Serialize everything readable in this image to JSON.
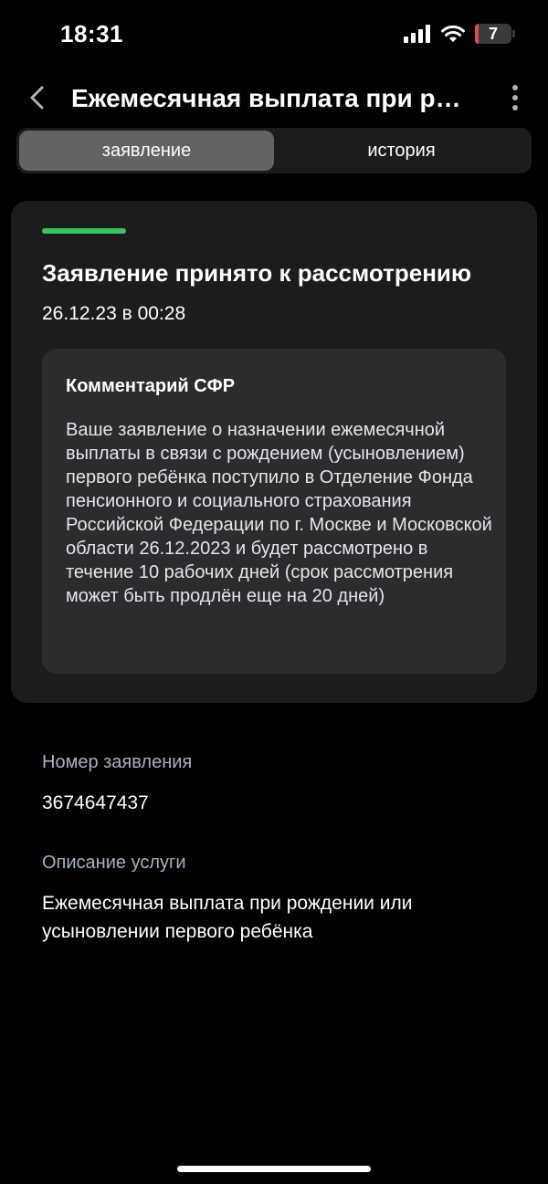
{
  "status_bar": {
    "time": "18:31",
    "battery_level": "7",
    "icons": [
      "cellular-signal-icon",
      "wifi-icon",
      "battery-icon"
    ]
  },
  "header": {
    "title": "Ежемесячная выплата при рождении или усыновлении первого ребёнка",
    "back_icon": "chevron-left-icon",
    "more_icon": "more-vertical-icon"
  },
  "tabs": [
    {
      "label": "заявление",
      "active": true
    },
    {
      "label": "история",
      "active": false
    }
  ],
  "status_card": {
    "title": "Заявление принято к рассмотрению",
    "date": "26.12.23 в 00:28",
    "accent_color": "#34c759",
    "comment": {
      "title": "Комментарий СФР",
      "body": "Ваше заявление о назначении ежемесячной выплаты в связи с рождением (усыновлением) первого ребёнка поступило в Отделение Фонда пенсионного и социального страхования Российской Федерации по г. Москве и Московской области 26.12.2023 и будет рассмотрено в течение 10 рабочих дней (срок рассмотрения может быть продлён еще на 20 дней)"
    }
  },
  "details": {
    "number_label": "Номер заявления",
    "number_value": "3674647437",
    "description_label": "Описание услуги",
    "description_value": "Ежемесячная выплата при рождении или усыновлении первого ребёнка"
  }
}
